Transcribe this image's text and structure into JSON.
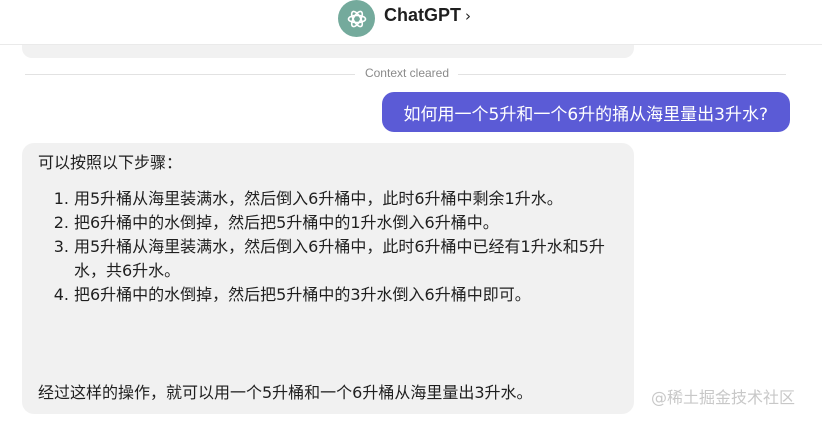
{
  "header": {
    "title": "ChatGPT",
    "chevron": "›",
    "logo_icon": "openai-logo-icon",
    "logo_color": "#74aa9c"
  },
  "divider": {
    "label": "Context cleared"
  },
  "user_message": {
    "text": "如何用一个5升和一个6升的捅从海里量出3升水?",
    "bubble_color": "#5b5bd6"
  },
  "assistant_message": {
    "intro": "可以按照以下步骤：",
    "steps": [
      {
        "num": "1.",
        "text": "用5升桶从海里装满水，然后倒入6升桶中，此时6升桶中剩余1升水。"
      },
      {
        "num": "2.",
        "text": "把6升桶中的水倒掉，然后把5升桶中的1升水倒入6升桶中。"
      },
      {
        "num": "3.",
        "text": "用5升桶从海里装满水，然后倒入6升桶中，此时6升桶中已经有1升水和5升水，共6升水。"
      },
      {
        "num": "4.",
        "text": "把6升桶中的水倒掉，然后把5升桶中的3升水倒入6升桶中即可。"
      }
    ],
    "conclusion": "经过这样的操作，就可以用一个5升桶和一个6升桶从海里量出3升水。",
    "bubble_color": "#f1f1f1"
  },
  "watermark": {
    "text": "@稀土掘金技术社区"
  }
}
